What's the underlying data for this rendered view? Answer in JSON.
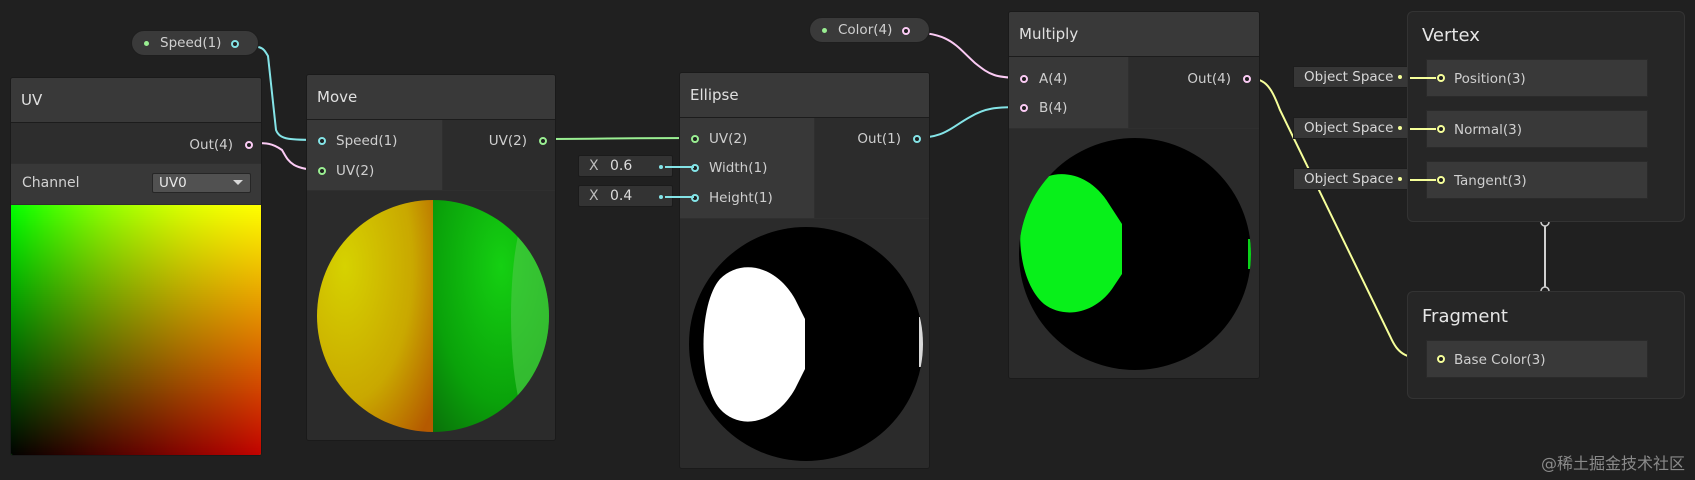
{
  "properties": {
    "speed": {
      "label": "Speed(1)"
    },
    "color": {
      "label": "Color(4)"
    }
  },
  "uv_node": {
    "title": "UV",
    "out_port": "Out(4)",
    "channel_label": "Channel",
    "channel_value": "UV0"
  },
  "move_node": {
    "title": "Move",
    "in_speed": "Speed(1)",
    "in_uv": "UV(2)",
    "out_uv": "UV(2)"
  },
  "ellipse_node": {
    "title": "Ellipse",
    "in_uv": "UV(2)",
    "in_width": "Width(1)",
    "in_height": "Height(1)",
    "out": "Out(1)",
    "width_axis": "X",
    "width_value": "0.6",
    "height_axis": "X",
    "height_value": "0.4"
  },
  "multiply_node": {
    "title": "Multiply",
    "in_a": "A(4)",
    "in_b": "B(4)",
    "out": "Out(4)"
  },
  "vertex": {
    "title": "Vertex",
    "slots": [
      {
        "space": "Object Space",
        "label": "Position(3)"
      },
      {
        "space": "Object Space",
        "label": "Normal(3)"
      },
      {
        "space": "Object Space",
        "label": "Tangent(3)"
      }
    ]
  },
  "fragment": {
    "title": "Fragment",
    "slots": [
      {
        "label": "Base Color(3)"
      }
    ]
  },
  "watermark": "@稀土掘金技术社区",
  "colors": {
    "canvas": "#202020",
    "vector1_port": "#84e4e7",
    "vector2_port": "#9aef92",
    "vector4_port": "#fbcbf4",
    "vector3_port": "#f6ff9a"
  }
}
